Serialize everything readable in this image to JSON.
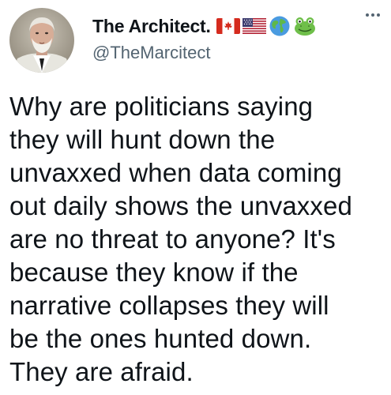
{
  "author": {
    "display_name": "The Architect.",
    "handle": "@TheMarcitect",
    "name_emojis": [
      "canada-flag-icon",
      "us-flag-icon",
      "globe-icon",
      "frog-icon"
    ]
  },
  "tweet": {
    "lines": [
      "Why are politicians saying",
      "they will hunt down the",
      "unvaxxed when data coming",
      "out daily shows the unvaxxed",
      "are no threat to anyone? It's",
      "because they know if the",
      "narrative collapses they will",
      "be the ones hunted down.",
      "They are afraid."
    ]
  },
  "colors": {
    "text": "#0f1419",
    "secondary": "#536471",
    "background": "#ffffff"
  }
}
